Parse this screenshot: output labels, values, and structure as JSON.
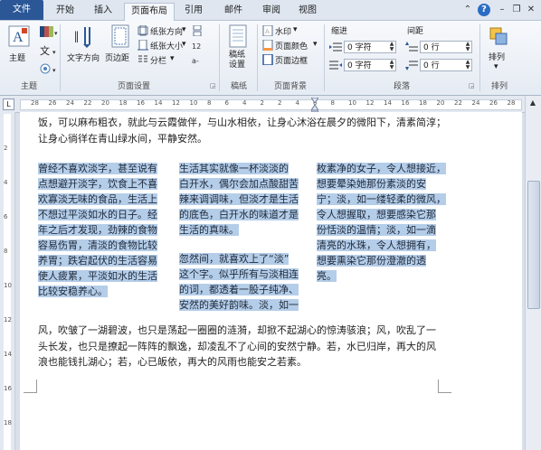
{
  "tabs": {
    "file": "文件",
    "items": [
      "开始",
      "插入",
      "页面布局",
      "引用",
      "邮件",
      "审阅",
      "视图"
    ],
    "active": "页面布局"
  },
  "window": {
    "help_glyph": "?"
  },
  "ribbon": {
    "theme_group": {
      "label": "主题",
      "theme_button": "主题"
    },
    "page_setup_group": {
      "label": "页面设置",
      "text_direction": "文字方向",
      "margins": "页边距",
      "orientation": "纸张方向",
      "size": "纸张大小",
      "columns": "分栏"
    },
    "manuscript_group": {
      "label": "稿纸",
      "manuscript_settings": "稿纸\n设置"
    },
    "page_background_group": {
      "label": "页面背景",
      "watermark": "水印",
      "page_color": "页面颜色",
      "page_borders": "页面边框"
    },
    "paragraph_group": {
      "label": "段落",
      "indent_header": "缩进",
      "spacing_header": "间距",
      "indent_left": "0 字符",
      "indent_right": "0 字符",
      "spacing_before": "0 行",
      "spacing_after": "0 行"
    },
    "arrange_group": {
      "label": "排列",
      "arrange": "排列"
    }
  },
  "ruler": {
    "numbers": [
      "28",
      "26",
      "24",
      "22",
      "20",
      "18",
      "16",
      "14",
      "12",
      "10",
      "8",
      "6",
      "4",
      "2",
      "2",
      "4",
      "6",
      "8",
      "10",
      "12",
      "14",
      "16",
      "18",
      "20",
      "22",
      "24",
      "26",
      "28"
    ],
    "vnumbers": [
      "2",
      "4",
      "6",
      "8",
      "10",
      "12",
      "14",
      "16",
      "18"
    ]
  },
  "document": {
    "top_lines": [
      "饭，可以麻布粗衣，就此与云霞做伴，与山水相依，让身心沐浴在晨夕的微阳下，清素简淳；",
      "让身心徜徉在青山绿水间，平静安然。"
    ],
    "col1": [
      "曾经不喜欢淡字，甚至说有",
      "点想避开淡字，饮食上不喜",
      "欢寡淡无味的食品，生活上",
      "不想过平淡如水的日子。经",
      "年之后才发现，劲辣的食物",
      "容易伤胃，清淡的食物比较",
      "养胃；跌宕起伏的生活容易",
      "使人疲累，平淡如水的生活",
      "比较安稳养心。"
    ],
    "col2a": [
      "生活其实就像一杯淡淡的",
      "白开水，偶尔会加点酸甜苦",
      "辣来调调味，但淡才是生活",
      "的底色，白开水的味道才是",
      "生活的真味。"
    ],
    "col2b": [
      "忽然间，就喜欢上了“淡”",
      "这个字。似乎所有与淡相连",
      "的词，都透着一股子纯净、",
      "安然的美好韵味。淡，如一"
    ],
    "col3": [
      "枚素净的女子，令人想接近，",
      "想要晕染她那份素淡的安",
      "宁；淡，如一缕轻柔的微风，",
      "令人想握取，想要感染它那",
      "份恬淡的温情；淡，如一滴",
      "清亮的水珠，令人想拥有，",
      "想要熏染它那份澄澈的透",
      "亮。"
    ],
    "bottom_lines": [
      "风，吹皱了一湖碧波，也只是荡起一圈圈的涟漪，却掀不起湖心的惊涛骇浪；风，吹乱了一",
      "头长发，也只是撩起一阵阵的飘逸，却凌乱不了心间的安然宁静。若，水已归岸，再大的风",
      "浪也能钱扎湖心；若，心已皈依，再大的风雨也能安之若素。"
    ]
  },
  "colors": {
    "accent": "#2b5797",
    "selection": "#b4cde9"
  }
}
